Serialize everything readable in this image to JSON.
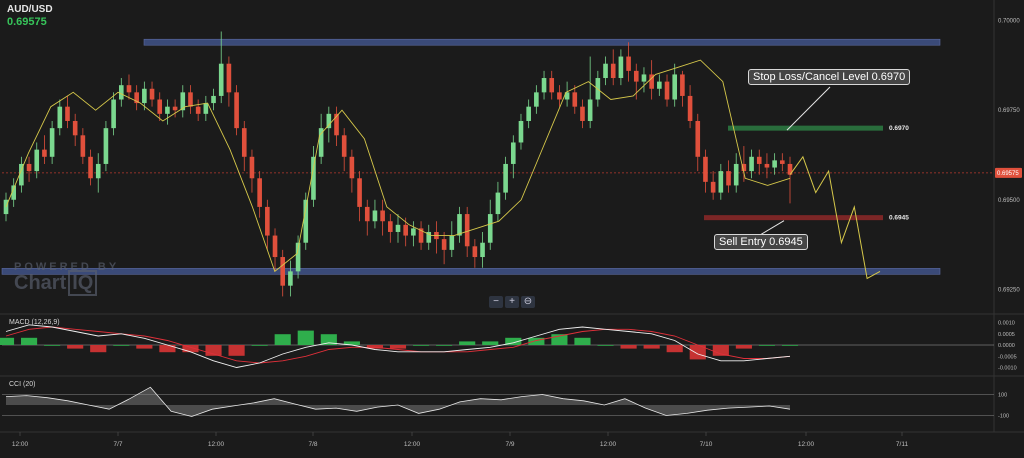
{
  "symbol": {
    "name": "AUD/USD",
    "price": "0.69575"
  },
  "watermark": {
    "line1": "POWERED BY",
    "line2a": "Chart",
    "line2b": "IQ"
  },
  "zoom": {
    "minus": "−",
    "plus": "+",
    "reset": "⊖"
  },
  "annotations": {
    "stop_loss": "Stop Loss/Cancel Level 0.6970",
    "sell_entry": "Sell Entry 0.6945",
    "level_6970": "0.6970",
    "level_6945": "0.6945"
  },
  "macd": {
    "label": "MACD (12,26,9)",
    "ticks": [
      "0.0010",
      "0.0005",
      "0.0000",
      "-0.0005",
      "-0.0010"
    ]
  },
  "cci": {
    "label": "CCI (20)",
    "ticks": [
      "100",
      "-100"
    ]
  },
  "colors": {
    "bull": "#7bd88f",
    "bear": "#e0503c",
    "ma": "#d6c84a",
    "zone": "#3a4a78",
    "green_level": "#2f8a48",
    "red_level": "#9e2b2b",
    "macd_line": "#f0f0f0",
    "signal_line": "#e0303a",
    "price_badge": "#e0503c"
  },
  "chart_data": {
    "type": "candlestick",
    "title": "AUD/USD",
    "ylim": [
      0.6922,
      0.7003
    ],
    "y_ticks": [
      "0.70000",
      "0.69750",
      "0.69500",
      "0.69250"
    ],
    "current_price": "0.69575",
    "x_ticks": [
      "12:00",
      "7/7",
      "12:00",
      "7/8",
      "12:00",
      "7/9",
      "12:00",
      "7/10",
      "12:00",
      "7/11"
    ],
    "zones": [
      {
        "name": "resistance zone",
        "value": 0.6994
      },
      {
        "name": "support zone",
        "value": 0.693
      }
    ],
    "levels": [
      {
        "name": "Stop Loss/Cancel Level",
        "value": 0.697
      },
      {
        "name": "Sell Entry",
        "value": 0.6945
      }
    ],
    "ma_anchor_values": [
      0.6948,
      0.6963,
      0.6976,
      0.698,
      0.6975,
      0.698,
      0.6977,
      0.6972,
      0.6976,
      0.6977,
      0.6964,
      0.6948,
      0.693,
      0.6935,
      0.6968,
      0.6975,
      0.6967,
      0.6948,
      0.6943,
      0.694,
      0.694,
      0.6942,
      0.6944,
      0.695,
      0.6965,
      0.698,
      0.6983,
      0.6978,
      0.6979,
      0.6985,
      0.6987,
      0.6989,
      0.6983,
      0.6956,
      0.6954,
      0.6956
    ],
    "projection_values": [
      0.6957,
      0.6962,
      0.6952,
      0.6958,
      0.6938,
      0.6948,
      0.6928,
      0.693
    ],
    "candles": [
      [
        0.6946,
        0.695,
        0.6944,
        0.6952
      ],
      [
        0.695,
        0.6954,
        0.6948,
        0.6956
      ],
      [
        0.6954,
        0.696,
        0.6952,
        0.6962
      ],
      [
        0.696,
        0.6958,
        0.6955,
        0.6962
      ],
      [
        0.6958,
        0.6964,
        0.6956,
        0.6966
      ],
      [
        0.6964,
        0.6962,
        0.696,
        0.6968
      ],
      [
        0.6962,
        0.697,
        0.696,
        0.6972
      ],
      [
        0.697,
        0.6976,
        0.6968,
        0.6978
      ],
      [
        0.6976,
        0.6972,
        0.697,
        0.6979
      ],
      [
        0.6972,
        0.6968,
        0.6965,
        0.6974
      ],
      [
        0.6968,
        0.6962,
        0.696,
        0.697
      ],
      [
        0.6962,
        0.6956,
        0.6954,
        0.6964
      ],
      [
        0.6956,
        0.696,
        0.6952,
        0.6963
      ],
      [
        0.696,
        0.697,
        0.6958,
        0.6972
      ],
      [
        0.697,
        0.6978,
        0.6968,
        0.698
      ],
      [
        0.6978,
        0.6982,
        0.6976,
        0.6984
      ],
      [
        0.6982,
        0.698,
        0.6978,
        0.6985
      ],
      [
        0.698,
        0.6977,
        0.6975,
        0.6982
      ],
      [
        0.6977,
        0.6981,
        0.6975,
        0.6983
      ],
      [
        0.6981,
        0.6978,
        0.6976,
        0.6983
      ],
      [
        0.6978,
        0.6974,
        0.6972,
        0.698
      ],
      [
        0.6974,
        0.6976,
        0.6971,
        0.6978
      ],
      [
        0.6976,
        0.6975,
        0.6973,
        0.6978
      ],
      [
        0.6975,
        0.698,
        0.6973,
        0.6982
      ],
      [
        0.698,
        0.6976,
        0.6974,
        0.6982
      ],
      [
        0.6976,
        0.6974,
        0.6972,
        0.6978
      ],
      [
        0.6974,
        0.6977,
        0.6972,
        0.6979
      ],
      [
        0.6977,
        0.6979,
        0.6975,
        0.6981
      ],
      [
        0.6979,
        0.6988,
        0.6977,
        0.6997
      ],
      [
        0.6988,
        0.698,
        0.6976,
        0.699
      ],
      [
        0.698,
        0.697,
        0.6968,
        0.6982
      ],
      [
        0.697,
        0.6962,
        0.6958,
        0.6972
      ],
      [
        0.6962,
        0.6956,
        0.6952,
        0.6964
      ],
      [
        0.6956,
        0.6948,
        0.6945,
        0.6958
      ],
      [
        0.6948,
        0.694,
        0.6936,
        0.695
      ],
      [
        0.694,
        0.6934,
        0.693,
        0.6942
      ],
      [
        0.6934,
        0.6926,
        0.6923,
        0.6936
      ],
      [
        0.6926,
        0.693,
        0.6923,
        0.6933
      ],
      [
        0.693,
        0.6938,
        0.6928,
        0.694
      ],
      [
        0.6938,
        0.695,
        0.6936,
        0.6952
      ],
      [
        0.695,
        0.6962,
        0.6948,
        0.6965
      ],
      [
        0.6962,
        0.697,
        0.696,
        0.6974
      ],
      [
        0.697,
        0.6974,
        0.6966,
        0.6976
      ],
      [
        0.6974,
        0.6968,
        0.6965,
        0.6976
      ],
      [
        0.6968,
        0.6962,
        0.6958,
        0.697
      ],
      [
        0.6962,
        0.6956,
        0.6952,
        0.6964
      ],
      [
        0.6956,
        0.6948,
        0.6944,
        0.6958
      ],
      [
        0.6948,
        0.6944,
        0.694,
        0.695
      ],
      [
        0.6944,
        0.6947,
        0.6942,
        0.695
      ],
      [
        0.6947,
        0.6944,
        0.694,
        0.695
      ],
      [
        0.6944,
        0.6941,
        0.6938,
        0.6946
      ],
      [
        0.6941,
        0.6943,
        0.6938,
        0.6946
      ],
      [
        0.6943,
        0.694,
        0.6937,
        0.6945
      ],
      [
        0.694,
        0.6942,
        0.6937,
        0.6944
      ],
      [
        0.6942,
        0.6938,
        0.6936,
        0.6944
      ],
      [
        0.6938,
        0.6941,
        0.6936,
        0.6943
      ],
      [
        0.6941,
        0.6939,
        0.6935,
        0.6944
      ],
      [
        0.6939,
        0.6936,
        0.6932,
        0.6941
      ],
      [
        0.6936,
        0.694,
        0.6934,
        0.6944
      ],
      [
        0.694,
        0.6946,
        0.6938,
        0.6948
      ],
      [
        0.6946,
        0.6937,
        0.6934,
        0.6948
      ],
      [
        0.6937,
        0.6934,
        0.6931,
        0.6939
      ],
      [
        0.6934,
        0.6938,
        0.6931,
        0.6941
      ],
      [
        0.6938,
        0.6946,
        0.6936,
        0.695
      ],
      [
        0.6946,
        0.6952,
        0.6944,
        0.6955
      ],
      [
        0.6952,
        0.696,
        0.695,
        0.6962
      ],
      [
        0.696,
        0.6966,
        0.6956,
        0.6968
      ],
      [
        0.6966,
        0.6972,
        0.6964,
        0.6974
      ],
      [
        0.6972,
        0.6976,
        0.697,
        0.6978
      ],
      [
        0.6976,
        0.698,
        0.6974,
        0.6982
      ],
      [
        0.698,
        0.6984,
        0.6978,
        0.6986
      ],
      [
        0.6984,
        0.698,
        0.6978,
        0.6986
      ],
      [
        0.698,
        0.6978,
        0.6976,
        0.6982
      ],
      [
        0.6978,
        0.698,
        0.6976,
        0.6983
      ],
      [
        0.698,
        0.6976,
        0.6974,
        0.6982
      ],
      [
        0.6976,
        0.6972,
        0.697,
        0.6978
      ],
      [
        0.6972,
        0.6978,
        0.697,
        0.699
      ],
      [
        0.6978,
        0.6984,
        0.6976,
        0.6986
      ],
      [
        0.6984,
        0.6988,
        0.6982,
        0.699
      ],
      [
        0.6988,
        0.6984,
        0.6982,
        0.6992
      ],
      [
        0.6984,
        0.699,
        0.6982,
        0.6992
      ],
      [
        0.699,
        0.6986,
        0.6983,
        0.6994
      ],
      [
        0.6986,
        0.6983,
        0.6978,
        0.6988
      ],
      [
        0.6983,
        0.6985,
        0.698,
        0.6987
      ],
      [
        0.6985,
        0.6981,
        0.6978,
        0.6989
      ],
      [
        0.6981,
        0.6983,
        0.6979,
        0.6985
      ],
      [
        0.6983,
        0.6978,
        0.6976,
        0.6985
      ],
      [
        0.6978,
        0.6985,
        0.6976,
        0.6988
      ],
      [
        0.6985,
        0.6979,
        0.6976,
        0.6986
      ],
      [
        0.6979,
        0.6972,
        0.697,
        0.6982
      ],
      [
        0.6972,
        0.6962,
        0.6958,
        0.6974
      ],
      [
        0.6962,
        0.6955,
        0.6952,
        0.6964
      ],
      [
        0.6955,
        0.6952,
        0.695,
        0.6958
      ],
      [
        0.6952,
        0.6958,
        0.695,
        0.696
      ],
      [
        0.6958,
        0.6954,
        0.6952,
        0.6961
      ],
      [
        0.6954,
        0.696,
        0.6952,
        0.6963
      ],
      [
        0.696,
        0.6958,
        0.6955,
        0.6965
      ],
      [
        0.6958,
        0.6962,
        0.6956,
        0.6964
      ],
      [
        0.6962,
        0.696,
        0.6957,
        0.6964
      ],
      [
        0.696,
        0.6959,
        0.6956,
        0.6963
      ],
      [
        0.6959,
        0.6961,
        0.6957,
        0.6963
      ],
      [
        0.6961,
        0.696,
        0.6958,
        0.6963
      ],
      [
        0.696,
        0.6957,
        0.6949,
        0.6962
      ]
    ],
    "macd_series": {
      "macd": [
        0.0006,
        0.0009,
        0.0008,
        0.0006,
        0.0004,
        0.0005,
        0.0003,
        0.0,
        -0.0003,
        -0.0007,
        -0.001,
        -0.0008,
        -0.0004,
        -0.0001,
        0.0001,
        0.0,
        -0.0002,
        -0.0003,
        -0.0003,
        -0.0003,
        -0.0002,
        -0.0001,
        0.0001,
        0.0004,
        0.0007,
        0.0008,
        0.0007,
        0.0006,
        0.0005,
        0.0002,
        -0.0004,
        -0.0007,
        -0.0007,
        -0.0006,
        -0.0005
      ],
      "signal": [
        0.0004,
        0.0007,
        0.0008,
        0.0007,
        0.0006,
        0.0005,
        0.0004,
        0.0002,
        -0.0001,
        -0.0004,
        -0.0007,
        -0.0008,
        -0.0007,
        -0.0005,
        -0.0002,
        -0.0001,
        -0.0001,
        -0.0002,
        -0.0003,
        -0.0003,
        -0.0003,
        -0.0002,
        -0.0001,
        0.0002,
        0.0004,
        0.0006,
        0.0007,
        0.0007,
        0.0006,
        0.0004,
        0.0,
        -0.0004,
        -0.0006,
        -0.0006,
        -0.0005
      ]
    },
    "cci_series": [
      80,
      90,
      70,
      40,
      0,
      -40,
      60,
      170,
      -60,
      -110,
      -40,
      -10,
      20,
      60,
      10,
      -40,
      -30,
      -60,
      -20,
      0,
      -80,
      -40,
      30,
      60,
      50,
      80,
      100,
      60,
      40,
      0,
      60,
      -30,
      -100,
      -80,
      -50,
      -30,
      -20,
      -10,
      -40
    ]
  }
}
